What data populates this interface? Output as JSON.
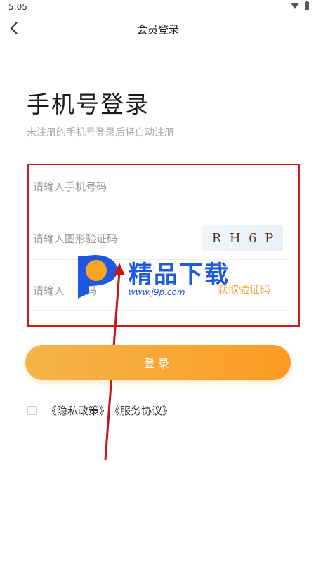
{
  "status_bar": {
    "time": "5:05",
    "wifi_icon": "wifi-icon",
    "battery_icon": "battery-icon"
  },
  "header": {
    "title": "会员登录",
    "back_icon": "back-arrow-icon"
  },
  "login": {
    "title": "手机号登录",
    "subtitle": "未注册的手机号登录后将自动注册",
    "phone_placeholder": "请输入手机号码",
    "captcha_placeholder": "请输入图形验证码",
    "captcha_text": [
      "R",
      "H",
      "6",
      "P"
    ],
    "sms_placeholder": "请输入",
    "sms_placeholder_tail": "信验",
    "sms_placeholder_end": "码",
    "get_code_label": "获取验证码",
    "button_label": "登录"
  },
  "agreement": {
    "privacy": "《隐私政策》",
    "service": "《服务协议》"
  },
  "watermark": {
    "title": "精品下载",
    "url": "www.j9p.com"
  },
  "colors": {
    "accent": "#f5a43a",
    "button_start": "#f5b54a",
    "button_end": "#fb9b23",
    "annotation": "#d11818",
    "watermark": "#1e58e0"
  }
}
